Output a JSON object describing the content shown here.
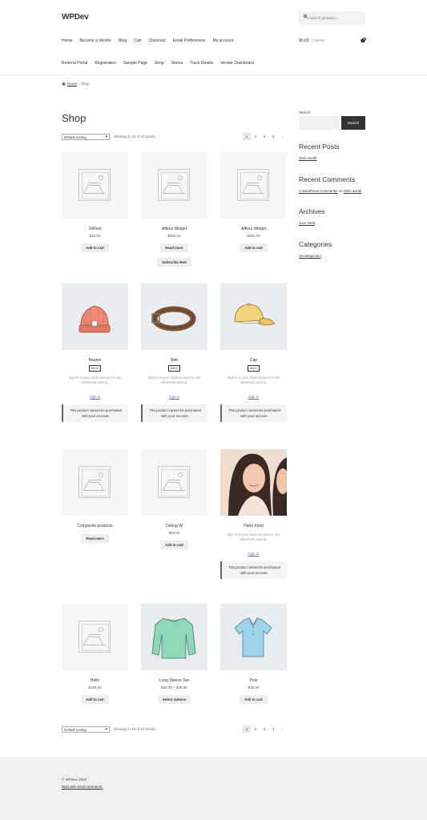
{
  "site": {
    "name": "WPDev"
  },
  "header": {
    "search_placeholder": "Search products...",
    "cart_amount": "$0.00",
    "cart_items": "0 items",
    "nav_row1": [
      "Home",
      "Become a Vendor",
      "Blog",
      "Cart",
      "Checkout",
      "Email Preferences",
      "My account"
    ],
    "nav_row2": [
      "Referral Portal",
      "Registration",
      "Sample Page",
      "Shop",
      "Stores",
      "Track Details",
      "Vendor Dashboard"
    ]
  },
  "breadcrumb": {
    "home": "Home",
    "separator": "/",
    "current": "Shop"
  },
  "page_title": "Shop",
  "toolbar": {
    "sorting": "Default sorting",
    "result_count": "Showing 1–12 of 42 results",
    "pages": [
      "1",
      "2",
      "3",
      "4",
      "→"
    ]
  },
  "products": [
    {
      "title": "10Rent",
      "price": "$15.00",
      "buttons": [
        "Add to cart"
      ]
    },
    {
      "title": "Affires Widget",
      "price": "$250.00",
      "buttons": [
        "Read more",
        "Subscribe Now"
      ]
    },
    {
      "title": "Affires Widget",
      "price": "$250.00",
      "buttons": [
        "Add to cart"
      ]
    },
    {
      "title": "Beanie",
      "sale": "SALE!",
      "trade_note": "Sign in to your trade account to see wholesale pricing.",
      "sign_in": "Sign in",
      "notice": "This product cannot be purchased with your account."
    },
    {
      "title": "Belt",
      "sale": "SALE!",
      "trade_note": "Sign in to your trade account to see wholesale pricing.",
      "sign_in": "Sign in",
      "notice": "This product cannot be purchased with your account."
    },
    {
      "title": "Cap",
      "sale": "SALE!",
      "trade_note": "Sign in to your trade account to see wholesale pricing.",
      "sign_in": "Sign in",
      "notice": "This product cannot be purchased with your account."
    },
    {
      "title": "Composite products",
      "buttons": [
        "Read more"
      ]
    },
    {
      "title": "Debug W",
      "price": "$80.00",
      "buttons": [
        "Add to cart"
      ]
    },
    {
      "title": "Hand Paint",
      "trade_note": "Sign in to your trade account to see wholesale pricing.",
      "sign_in": "Sign in",
      "notice": "This product cannot be purchased with your account."
    },
    {
      "title": "Hello",
      "price": "$100.00",
      "buttons": [
        "Add to cart"
      ]
    },
    {
      "title": "Long Sleeve Tee",
      "price": "$30.00 – $38.00",
      "buttons": [
        "Select options"
      ]
    },
    {
      "title": "Polo",
      "price": "$35.00",
      "buttons": [
        "Add to cart"
      ]
    }
  ],
  "sidebar": {
    "search_label": "Search",
    "search_button": "Search",
    "recent_posts_title": "Recent Posts",
    "recent_post": "Hello world!",
    "recent_comments_title": "Recent Comments",
    "comment_author": "A WordPress Commenter",
    "comment_on": "on",
    "comment_post": "Hello world!",
    "archives_title": "Archives",
    "archive_item": "June 2026",
    "categories_title": "Categories",
    "category_item": "Uncategorized"
  },
  "footer": {
    "copyright": "© WPDev 2026",
    "built_with": "Built with WooCommerce."
  },
  "colors": {
    "accent": "#7f54b3",
    "dark_button": "#333333",
    "placeholder_bg": "#f5f6f5",
    "footer_bg": "#f0f0f0"
  }
}
